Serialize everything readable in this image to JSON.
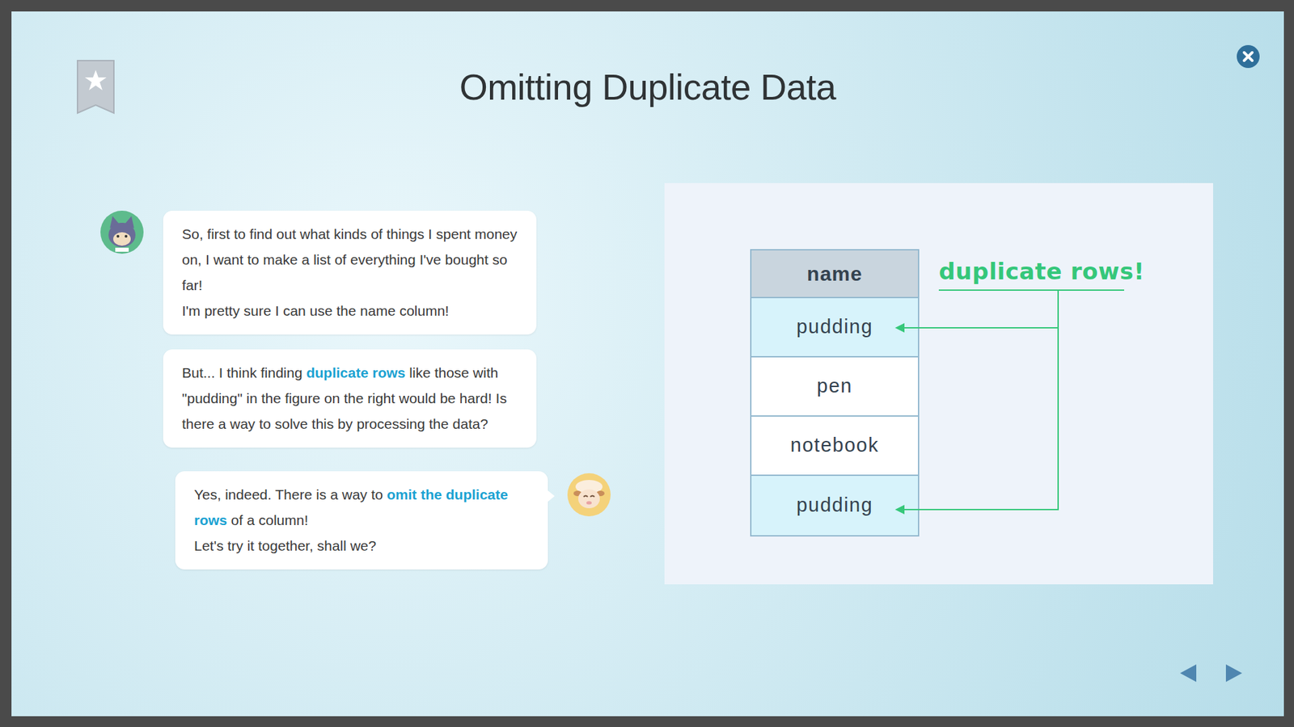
{
  "title": "Omitting Duplicate Data",
  "bookmark": {
    "bookmarked": false
  },
  "messages": [
    {
      "kind": "student",
      "paragraphs": [
        [
          {
            "text": "So, first to find out what kinds of things I spent money on, I want to make a list of everything I've bought so far!",
            "highlight": false
          }
        ],
        [
          {
            "text": "I'm pretty sure I can use the name column!",
            "highlight": false
          }
        ]
      ]
    },
    {
      "kind": "student",
      "paragraphs": [
        [
          {
            "text": "But... I think finding ",
            "highlight": false
          },
          {
            "text": "duplicate rows",
            "highlight": true
          },
          {
            "text": " like those with \"pudding\" in the figure on the right would be hard! Is there a way to solve this by processing the data?",
            "highlight": false
          }
        ]
      ]
    },
    {
      "kind": "teacher",
      "paragraphs": [
        [
          {
            "text": "Yes, indeed. There is a way to ",
            "highlight": false
          },
          {
            "text": "omit the duplicate rows",
            "highlight": true
          },
          {
            "text": " of a column!",
            "highlight": false
          }
        ],
        [
          {
            "text": "Let's try it together, shall we?",
            "highlight": false
          }
        ]
      ]
    }
  ],
  "figure": {
    "label": "duplicate rows!",
    "table": {
      "header": "name",
      "rows": [
        {
          "text": "pudding",
          "duplicate": true
        },
        {
          "text": "pen",
          "duplicate": false
        },
        {
          "text": "notebook",
          "duplicate": false
        },
        {
          "text": "pudding",
          "duplicate": true
        }
      ]
    }
  }
}
